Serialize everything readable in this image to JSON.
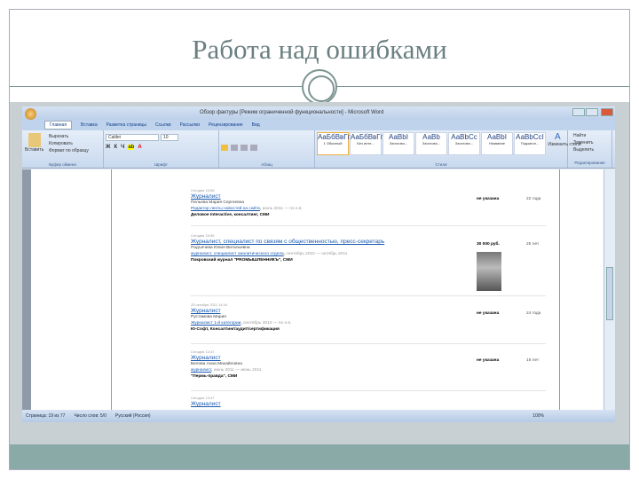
{
  "slide": {
    "title": "Работа над ошибками"
  },
  "window": {
    "title": "Обзор фактуры [Режим ограниченной функциональности] - Microsoft Word"
  },
  "tabs": [
    "Главная",
    "Вставка",
    "Разметка страницы",
    "Ссылки",
    "Рассылки",
    "Рецензирование",
    "Вид"
  ],
  "clipboard": {
    "paste": "Вставить",
    "cut": "Вырезать",
    "copy": "Копировать",
    "format": "Формат по образцу",
    "label": "Буфер обмена"
  },
  "font": {
    "name": "Calibri",
    "size": "10",
    "label": "Шрифт"
  },
  "paragraph": {
    "label": "Абзац"
  },
  "styles": {
    "label": "Стили",
    "change": "Изменить стили",
    "items": [
      {
        "sample": "АаБбВвГг",
        "name": "1 Обычный"
      },
      {
        "sample": "АаБбВвГг",
        "name": "Без инте..."
      },
      {
        "sample": "АаBbI",
        "name": "Заголово..."
      },
      {
        "sample": "АаBb",
        "name": "Заголово..."
      },
      {
        "sample": "АаBbCc",
        "name": "Заголово..."
      },
      {
        "sample": "АаBbI",
        "name": "Название"
      },
      {
        "sample": "АаBbCcI",
        "name": "Подзагол..."
      }
    ]
  },
  "editing": {
    "label": "Редактирование",
    "find": "Найти",
    "replace": "Заменить",
    "select": "Выделить"
  },
  "entries": [
    {
      "date": "Сегодня 15:58",
      "position": "Журналист",
      "name": "Пельева Мария Сергеевна",
      "job": "Редактор ленты новостей на сайте",
      "period": "июль 2011 — по н.в.",
      "company": "Деловое Interactive, консалтинг, СМИ",
      "salary": "не указана",
      "age": "22 года"
    },
    {
      "date": "Сегодня 15:56",
      "position": "Журналист, специалист по связям с общественностью, пресс-секретарь",
      "name": "Подъячева Юлия Витальевна",
      "job": "журналист, специалист аналитического отдела",
      "period": "сентябрь 2010 — октябрь 2011",
      "company": "Покровский журнал \"PROМЫШЛЕННИКЪ\", СМИ",
      "salary": "30 000 руб.",
      "age": "25 лет"
    },
    {
      "date": "25 октября 2011 14:44",
      "position": "Журналист",
      "name": "Рустамова Мария",
      "job": "Журналист 1-й категории",
      "period": "сентябрь 2010 — по н.в.",
      "company": "Ю-Софт, Консалтинг/аудит/сертификация",
      "salary": "не указана",
      "age": "24 года"
    },
    {
      "date": "Сегодня 13:47",
      "position": "Журналист",
      "name": "Белова Анна Михайловна",
      "job": "журналист",
      "period": "июнь 2011 — июнь 2011",
      "company": "\"Пермь-правда\", СМИ",
      "salary": "не указана",
      "age": "19 лет"
    },
    {
      "date": "Сегодня 13:47",
      "position": "Журналист"
    }
  ],
  "status": {
    "page": "Страница: 19 из 77",
    "words": "Число слов: 5/0",
    "lang": "Русский (Россия)",
    "zoom": "100%"
  }
}
